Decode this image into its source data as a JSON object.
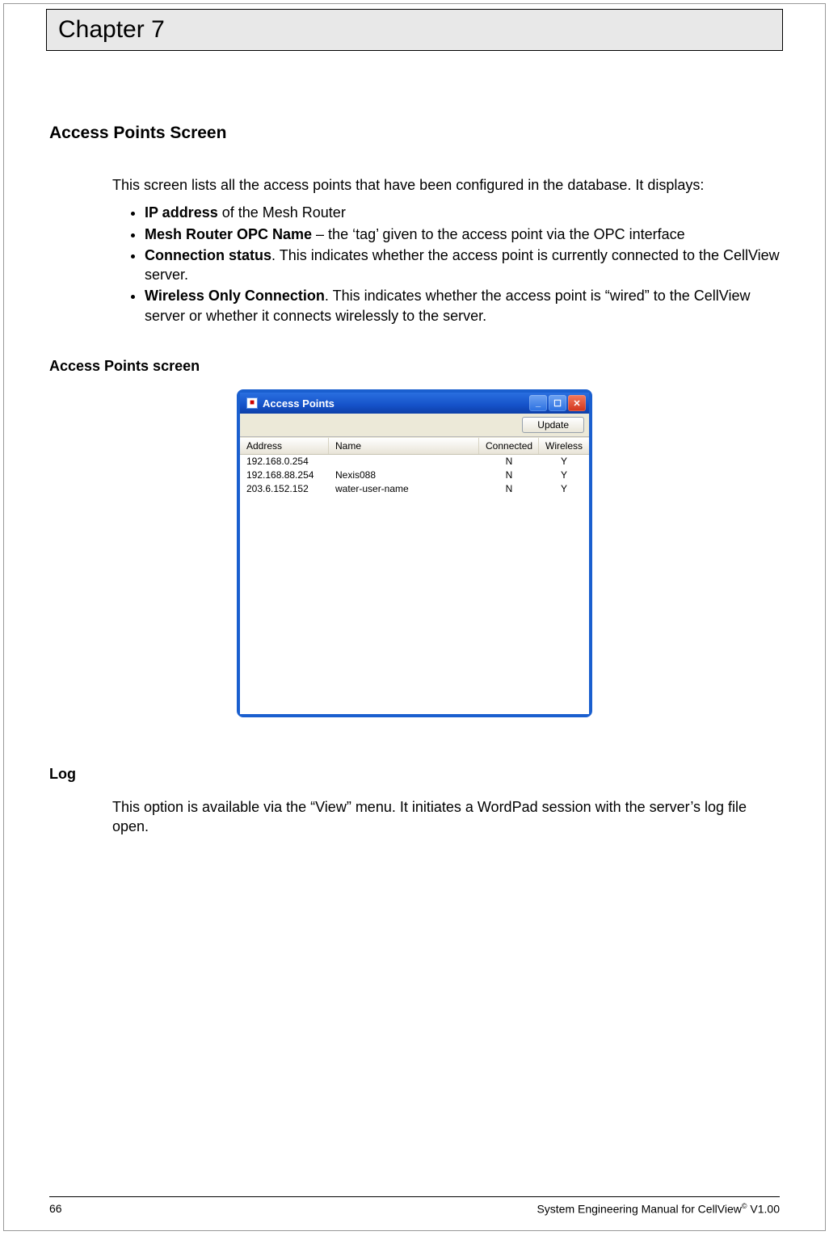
{
  "chapter": "Chapter 7",
  "section1_title": "Access Points Screen",
  "intro": "This screen lists all the access points that have been configured in the database.  It displays:",
  "bullets": [
    {
      "bold": "IP address",
      "rest": " of the Mesh Router"
    },
    {
      "bold": "Mesh Router OPC Name",
      "rest": " – the ‘tag’ given to the access point via the OPC interface"
    },
    {
      "bold": "Connection status",
      "rest": ".  This indicates whether the access point is currently connected to the CellView server."
    },
    {
      "bold": "Wireless Only Connection",
      "rest": ".  This indicates whether the access point is “wired” to the CellView server or whether it connects wirelessly to the server."
    }
  ],
  "subsection_caption": "Access Points screen",
  "window": {
    "title": "Access Points",
    "update_label": "Update",
    "columns": {
      "address": "Address",
      "name": "Name",
      "connected": "Connected",
      "wireless": "Wireless"
    },
    "rows": [
      {
        "address": "192.168.0.254",
        "name": "",
        "connected": "N",
        "wireless": "Y"
      },
      {
        "address": "192.168.88.254",
        "name": "Nexis088",
        "connected": "N",
        "wireless": "Y"
      },
      {
        "address": "203.6.152.152",
        "name": "water-user-name",
        "connected": "N",
        "wireless": "Y"
      }
    ]
  },
  "log_title": "Log",
  "log_text": "This option is available via the “View” menu.  It initiates a WordPad session with the server’s log file open.",
  "footer": {
    "page": "66",
    "rightA": "System Engineering Manual for CellView",
    "reg": "©",
    "rightB": " V1.00"
  }
}
